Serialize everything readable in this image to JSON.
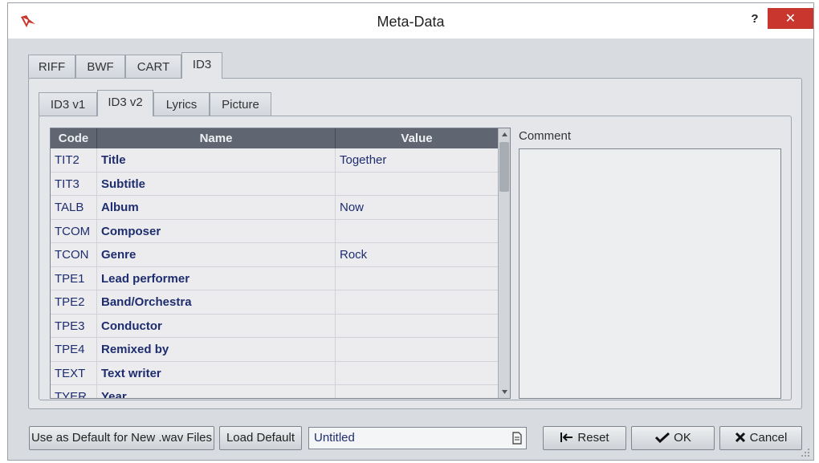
{
  "window": {
    "title": "Meta-Data",
    "help_label": "?",
    "close_label": "✕"
  },
  "outer_tabs": [
    {
      "label": "RIFF"
    },
    {
      "label": "BWF"
    },
    {
      "label": "CART"
    },
    {
      "label": "ID3",
      "active": true
    }
  ],
  "inner_tabs": [
    {
      "label": "ID3 v1"
    },
    {
      "label": "ID3 v2",
      "active": true
    },
    {
      "label": "Lyrics"
    },
    {
      "label": "Picture"
    }
  ],
  "table": {
    "columns": [
      "Code",
      "Name",
      "Value"
    ],
    "rows": [
      {
        "code": "TIT2",
        "name": "Title",
        "value": "Together"
      },
      {
        "code": "TIT3",
        "name": "Subtitle",
        "value": ""
      },
      {
        "code": "TALB",
        "name": "Album",
        "value": "Now"
      },
      {
        "code": "TCOM",
        "name": "Composer",
        "value": ""
      },
      {
        "code": "TCON",
        "name": "Genre",
        "value": "Rock"
      },
      {
        "code": "TPE1",
        "name": "Lead performer",
        "value": ""
      },
      {
        "code": "TPE2",
        "name": "Band/Orchestra",
        "value": ""
      },
      {
        "code": "TPE3",
        "name": "Conductor",
        "value": ""
      },
      {
        "code": "TPE4",
        "name": "Remixed by",
        "value": ""
      },
      {
        "code": "TEXT",
        "name": "Text writer",
        "value": ""
      },
      {
        "code": "TYER",
        "name": "Year",
        "value": ""
      }
    ]
  },
  "comment": {
    "label": "Comment",
    "value": ""
  },
  "footer": {
    "default_wav_label": "Use as Default for New .wav Files",
    "load_default_label": "Load Default",
    "preset_name": "Untitled",
    "reset_label": "Reset",
    "ok_label": "OK",
    "cancel_label": "Cancel"
  },
  "colors": {
    "close": "#c9362d",
    "header": "#5f6571",
    "text": "#1e2d6e",
    "brand": "#c9362d"
  }
}
